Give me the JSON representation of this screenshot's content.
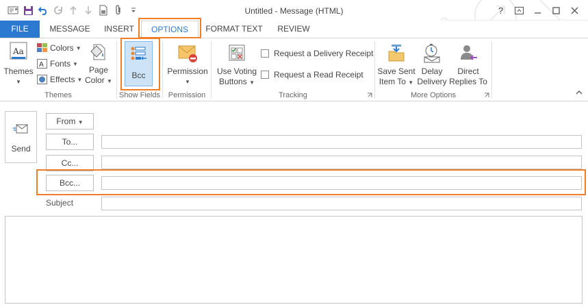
{
  "window": {
    "title": "Untitled - Message (HTML)",
    "help": "?",
    "quick_access": [
      "send-mail-icon",
      "save-icon",
      "undo-icon",
      "redo-icon",
      "up-icon",
      "down-icon",
      "document-icon",
      "attach-icon",
      "more-icon"
    ]
  },
  "tabs": [
    {
      "label": "FILE"
    },
    {
      "label": "MESSAGE"
    },
    {
      "label": "INSERT"
    },
    {
      "label": "OPTIONS"
    },
    {
      "label": "FORMAT TEXT"
    },
    {
      "label": "REVIEW"
    }
  ],
  "active_tab": "OPTIONS",
  "ribbon": {
    "themes": {
      "themes_label": "Themes",
      "colors_label": "Colors",
      "fonts_label": "Fonts",
      "effects_label": "Effects",
      "page_color_line1": "Page",
      "page_color_line2": "Color",
      "group_label": "Themes"
    },
    "show_fields": {
      "bcc_label": "Bcc",
      "group_label": "Show Fields"
    },
    "permission": {
      "permission_label": "Permission",
      "group_label": "Permission"
    },
    "tracking": {
      "voting_line1": "Use Voting",
      "voting_line2": "Buttons",
      "delivery_receipt": "Request a Delivery Receipt",
      "read_receipt": "Request a Read Receipt",
      "group_label": "Tracking"
    },
    "more_options": {
      "save_sent_line1": "Save Sent",
      "save_sent_line2": "Item To",
      "delay_line1": "Delay",
      "delay_line2": "Delivery",
      "direct_line1": "Direct",
      "direct_line2": "Replies To",
      "group_label": "More Options"
    }
  },
  "compose": {
    "send_label": "Send",
    "from_label": "From",
    "to_label": "To...",
    "cc_label": "Cc...",
    "bcc_label": "Bcc...",
    "subject_label": "Subject",
    "to_value": "",
    "cc_value": "",
    "bcc_value": "",
    "subject_value": "",
    "body_value": ""
  },
  "colors": {
    "accent": "#2b79d0",
    "highlight": "#f07d27"
  }
}
